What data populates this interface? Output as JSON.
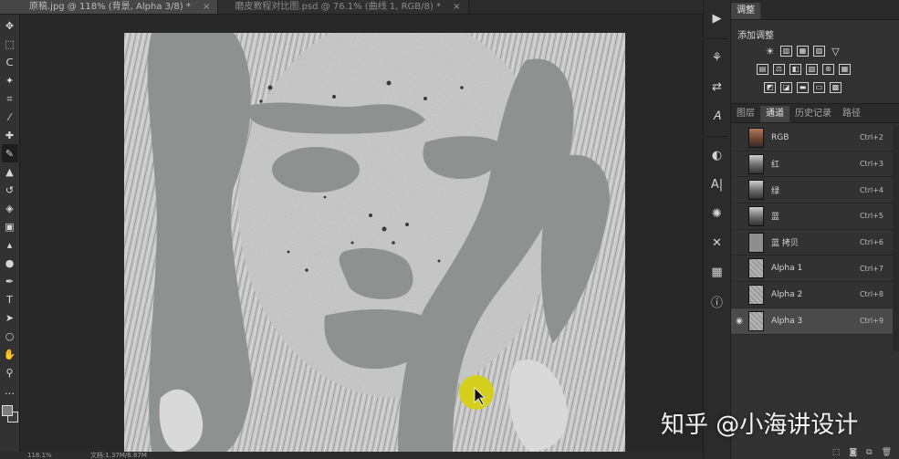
{
  "document_tabs": [
    {
      "title": "原稿.jpg @ 118% (背景, Alpha 3/8) *",
      "close": "×"
    },
    {
      "title": "磨皮教程对比图.psd @ 76.1% (曲线 1, RGB/8) *",
      "close": "×"
    }
  ],
  "tools": [
    {
      "icon": "move-tool-icon",
      "glyph": "✥"
    },
    {
      "icon": "marquee-tool-icon",
      "glyph": "⬚"
    },
    {
      "icon": "lasso-tool-icon",
      "glyph": "ᑕ"
    },
    {
      "icon": "magic-wand-tool-icon",
      "glyph": "✦"
    },
    {
      "icon": "crop-tool-icon",
      "glyph": "⌗"
    },
    {
      "icon": "eyedropper-tool-icon",
      "glyph": "⁄"
    },
    {
      "icon": "healing-brush-tool-icon",
      "glyph": "✚"
    },
    {
      "icon": "brush-tool-icon",
      "glyph": "✎"
    },
    {
      "icon": "clone-stamp-tool-icon",
      "glyph": "▲"
    },
    {
      "icon": "history-brush-tool-icon",
      "glyph": "↺"
    },
    {
      "icon": "eraser-tool-icon",
      "glyph": "◈"
    },
    {
      "icon": "gradient-tool-icon",
      "glyph": "▣"
    },
    {
      "icon": "blur-tool-icon",
      "glyph": "▴"
    },
    {
      "icon": "dodge-tool-icon",
      "glyph": "●"
    },
    {
      "icon": "pen-tool-icon",
      "glyph": "✒"
    },
    {
      "icon": "type-tool-icon",
      "glyph": "T"
    },
    {
      "icon": "path-selection-tool-icon",
      "glyph": "➤"
    },
    {
      "icon": "ellipse-tool-icon",
      "glyph": "○"
    },
    {
      "icon": "hand-tool-icon",
      "glyph": "✋"
    },
    {
      "icon": "zoom-tool-icon",
      "glyph": "⚲"
    },
    {
      "icon": "more-tools-icon",
      "glyph": "…"
    }
  ],
  "status": {
    "zoom": "118.1%",
    "doc": "文档:1.37M/6.87M"
  },
  "adjustments": {
    "tab_label": "调整",
    "title": "添加调整",
    "row1": [
      "☀",
      "▥",
      "▦",
      "▨",
      "▽"
    ],
    "row2": [
      "▤",
      "⚖",
      "◧",
      "▧",
      "⊛",
      "▦"
    ],
    "row3": [
      "◩",
      "◪",
      "▬",
      "▭",
      "▩"
    ]
  },
  "layers_tabs": [
    "图层",
    "通道",
    "历史记录",
    "路径"
  ],
  "channels": [
    {
      "name": "RGB",
      "shortcut": "Ctrl+2",
      "thumb": "color",
      "visible": false,
      "selected": false
    },
    {
      "name": "红",
      "shortcut": "Ctrl+3",
      "thumb": "gray",
      "visible": false,
      "selected": false
    },
    {
      "name": "绿",
      "shortcut": "Ctrl+4",
      "thumb": "gray",
      "visible": false,
      "selected": false
    },
    {
      "name": "蓝",
      "shortcut": "Ctrl+5",
      "thumb": "gray",
      "visible": false,
      "selected": false
    },
    {
      "name": "蓝 拷贝",
      "shortcut": "Ctrl+6",
      "thumb": "copy",
      "visible": false,
      "selected": false
    },
    {
      "name": "Alpha 1",
      "shortcut": "Ctrl+7",
      "thumb": "alpha",
      "visible": false,
      "selected": false
    },
    {
      "name": "Alpha 2",
      "shortcut": "Ctrl+8",
      "thumb": "alpha",
      "visible": false,
      "selected": false
    },
    {
      "name": "Alpha 3",
      "shortcut": "Ctrl+9",
      "thumb": "alpha",
      "visible": true,
      "selected": true
    }
  ],
  "watermark": "知乎 @小海讲设计",
  "colors": {
    "mask_gray": "#8d918f",
    "cursor_highlight": "#d4cf1c",
    "selected_row": "#4a4a4a"
  }
}
